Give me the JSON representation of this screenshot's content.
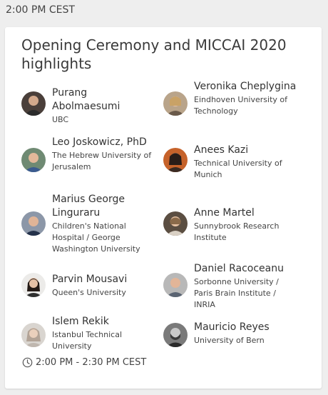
{
  "header": {
    "time": "2:00 PM CEST"
  },
  "session": {
    "title": "Opening Ceremony and MICCAI 2020 highlights",
    "time_range": "2:00 PM - 2:30 PM CEST"
  },
  "speakers": [
    {
      "name": "Purang Abolmaesumi",
      "affiliation": "UBC",
      "avatar": "avatar-photo"
    },
    {
      "name": "Veronika Cheplygina",
      "affiliation": "Eindhoven University of Technology",
      "avatar": "avatar-photo"
    },
    {
      "name": "Leo Joskowicz, PhD",
      "affiliation": "The Hebrew University of Jerusalem",
      "avatar": "avatar-photo"
    },
    {
      "name": "Anees Kazi",
      "affiliation": "Technical University of Munich",
      "avatar": "avatar-photo"
    },
    {
      "name": "Marius George Linguraru",
      "affiliation": "Children's National Hospital / George Washington University",
      "avatar": "avatar-photo"
    },
    {
      "name": "Anne Martel",
      "affiliation": "Sunnybrook Research Institute",
      "avatar": "avatar-photo"
    },
    {
      "name": "Parvin Mousavi",
      "affiliation": "Queen's University",
      "avatar": "avatar-photo"
    },
    {
      "name": "Daniel Racoceanu",
      "affiliation": "Sorbonne University / Paris Brain Institute / INRIA",
      "avatar": "avatar-photo"
    },
    {
      "name": "Islem Rekik",
      "affiliation": "Istanbul Technical University",
      "avatar": "avatar-photo"
    },
    {
      "name": "Mauricio Reyes",
      "affiliation": "University of Bern",
      "avatar": "avatar-photo"
    }
  ],
  "icons": {
    "clock": "clock-icon"
  }
}
